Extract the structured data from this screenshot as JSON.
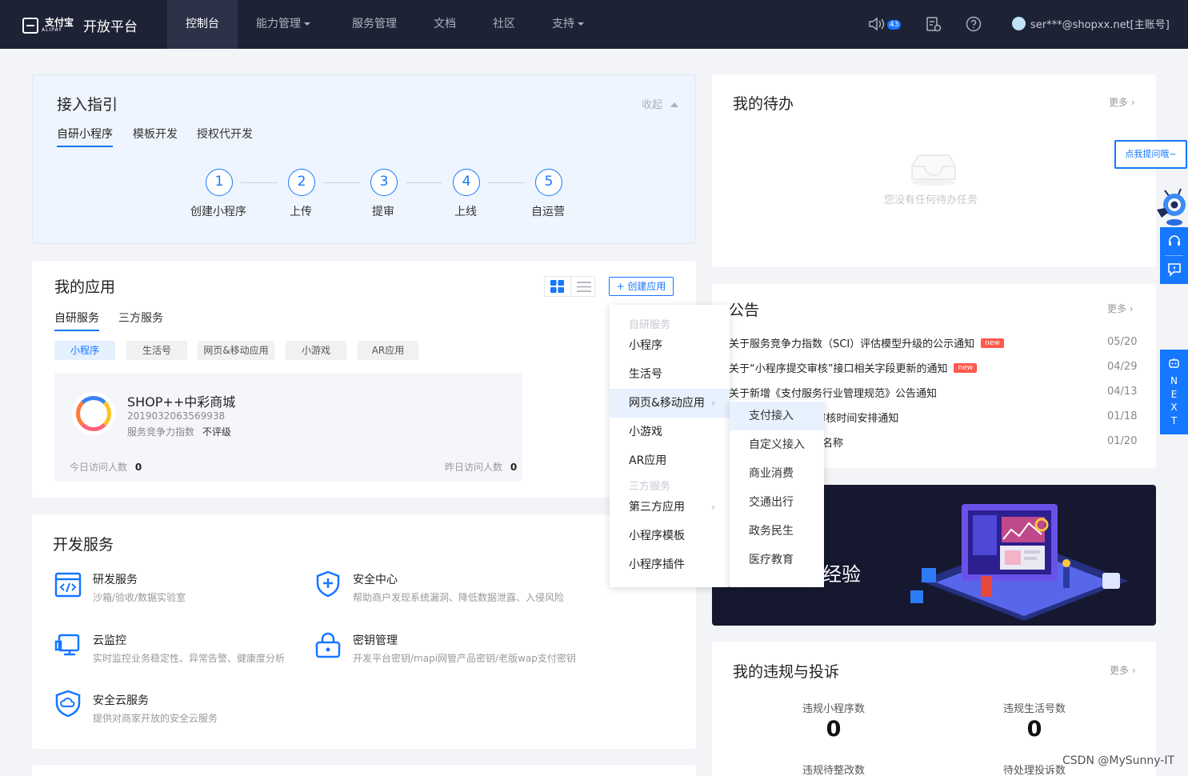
{
  "nav": {
    "logo_cn": "支付宝",
    "logo_en": "ALIPAY",
    "platform": "开放平台",
    "items": [
      {
        "label": "控制台",
        "dropdown": false
      },
      {
        "label": "能力管理",
        "dropdown": true
      },
      {
        "label": "服务管理",
        "dropdown": false
      },
      {
        "label": "文档",
        "dropdown": false
      },
      {
        "label": "社区",
        "dropdown": false
      },
      {
        "label": "支持",
        "dropdown": true
      }
    ],
    "notify_count": "43",
    "user": "ser***@shopxx.net[主账号]"
  },
  "guide": {
    "title": "接入指引",
    "collapse": "收起",
    "tabs": [
      "自研小程序",
      "模板开发",
      "授权代开发"
    ],
    "steps": [
      {
        "num": "1",
        "label": "创建小程序"
      },
      {
        "num": "2",
        "label": "上传"
      },
      {
        "num": "3",
        "label": "提审"
      },
      {
        "num": "4",
        "label": "上线"
      },
      {
        "num": "5",
        "label": "自运营"
      }
    ]
  },
  "apps": {
    "title": "我的应用",
    "create_button": "+ 创建应用",
    "tabs": [
      "自研服务",
      "三方服务"
    ],
    "chips": [
      "小程序",
      "生活号",
      "网页&移动应用",
      "小游戏",
      "AR应用"
    ],
    "card": {
      "name": "SHOP++中彩商城",
      "id": "2019032063569938",
      "score_label": "服务竞争力指数",
      "score_value": "不评级",
      "today_label": "今日访问人数",
      "today_value": "0",
      "yesterday_label": "昨日访问人数",
      "yesterday_value": "0"
    }
  },
  "dropdown": {
    "group1": "自研服务",
    "items1": [
      "小程序",
      "生活号",
      "网页&移动应用",
      "小游戏",
      "AR应用"
    ],
    "group2": "三方服务",
    "items2": [
      "第三方应用",
      "小程序模板",
      "小程序插件"
    ],
    "submenu": [
      "支付接入",
      "自定义接入",
      "商业消费",
      "交通出行",
      "政务民生",
      "医疗教育"
    ]
  },
  "dev": {
    "title": "开发服务",
    "services": [
      {
        "name": "研发服务",
        "desc": "沙箱/验收/数据实验室",
        "icon": "code-window-icon"
      },
      {
        "name": "安全中心",
        "desc": "帮助商户发现系统漏洞、降低数据泄露、入侵风险",
        "icon": "shield-plus-icon"
      },
      {
        "name": "云监控",
        "desc": "实时监控业务稳定性、异常告警、健康度分析",
        "icon": "monitor-icon"
      },
      {
        "name": "密钥管理",
        "desc": "开发平台密钥/mapi网管产品密钥/老版wap支付密钥",
        "icon": "lock-icon"
      },
      {
        "name": "安全云服务",
        "desc": "提供对商家开放的安全云服务",
        "icon": "cloud-shield-icon"
      }
    ]
  },
  "todo": {
    "title": "我的待办",
    "more": "更多",
    "empty": "您没有任何待办任务"
  },
  "notice": {
    "title": "公告",
    "more": "更多",
    "items": [
      {
        "text": "关于服务竞争力指数（SCI）评估模型升级的公示通知",
        "new": true,
        "date": "05/20"
      },
      {
        "text": "关于“小程序提交审核”接口相关字段更新的通知",
        "new": true,
        "date": "04/29"
      },
      {
        "text": "关于新增《支付服务行业管理规范》公告通知",
        "new": false,
        "date": "04/13"
      },
      {
        "text": "关于小程序/生活号审核时间安排通知",
        "new": false,
        "date": "01/18"
      },
      {
        "text": "关于小程序支持修改名称",
        "new": false,
        "date": "01/20"
      }
    ],
    "new_label": "new"
  },
  "banner": {
    "text": "经验"
  },
  "violations": {
    "title": "我的违规与投诉",
    "more": "更多",
    "stats": [
      {
        "label": "违规小程序数",
        "value": "0"
      },
      {
        "label": "违规生活号数",
        "value": "0"
      },
      {
        "label": "违规待整改数",
        "value": ""
      },
      {
        "label": "待处理投诉数",
        "value": ""
      }
    ]
  },
  "helper": {
    "tooltip": "点我提问哦~",
    "next_letters": [
      "N",
      "E",
      "X",
      "T"
    ]
  },
  "watermark": "CSDN @MySunny-IT",
  "colors": {
    "accent": "#1677ff",
    "nav_bg": "#1e2235",
    "new_tag": "#ff5a4e"
  }
}
